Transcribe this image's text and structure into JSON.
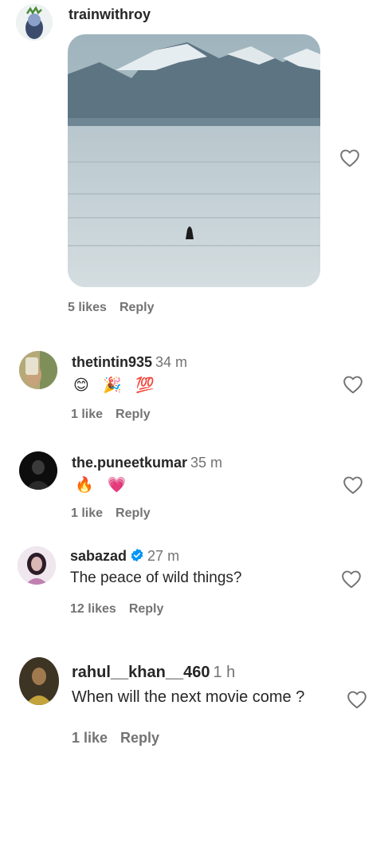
{
  "comments": [
    {
      "username": "trainwithroy",
      "time": "",
      "likes": "5 likes",
      "reply": "Reply"
    },
    {
      "username": "thetintin935",
      "time": "34 m",
      "emoji": "😊 🎉 💯",
      "likes": "1 like",
      "reply": "Reply"
    },
    {
      "username": "the.puneetkumar",
      "time": "35 m",
      "emoji": "🔥 💗",
      "likes": "1 like",
      "reply": "Reply"
    },
    {
      "username": "sabazad",
      "time": "27 m",
      "text": "The peace of wild things?",
      "likes": "12 likes",
      "reply": "Reply"
    },
    {
      "username": "rahul__khan__460",
      "time": "1 h",
      "text": "When will the next movie come ?",
      "likes": "1 like",
      "reply": "Reply"
    }
  ],
  "colors": {
    "text": "#262626",
    "muted": "#737373",
    "verified": "#0095f6"
  },
  "icons": {
    "like": "heart-outline-icon",
    "verified": "verified-badge-icon"
  }
}
